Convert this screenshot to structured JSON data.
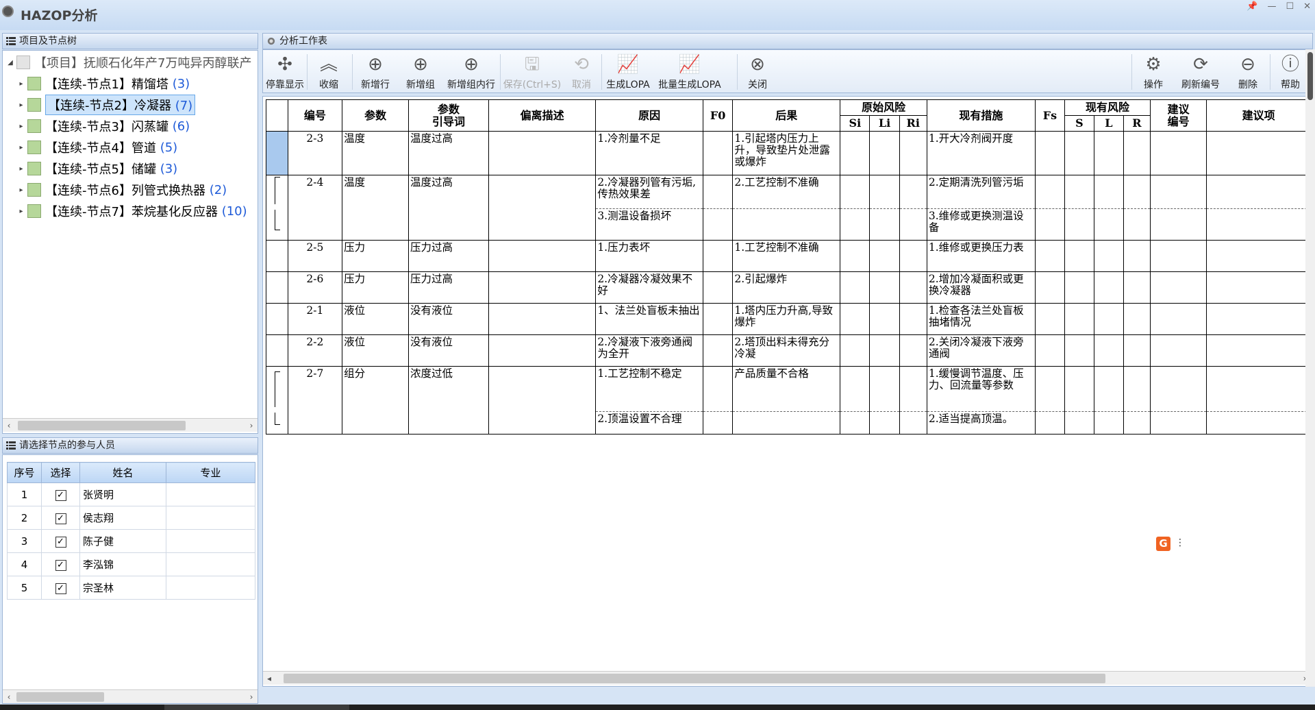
{
  "app": {
    "title": "HAZOP分析"
  },
  "window": {
    "pin": "📌",
    "minimize": "—",
    "maximize": "☐",
    "close": "✕"
  },
  "tree_panel": {
    "header": "项目及节点树",
    "project": "【项目】抚顺石化年产7万吨异丙醇联产",
    "nodes": [
      {
        "label": "【连续-节点1】精馏塔",
        "count": "(3)"
      },
      {
        "label": "【连续-节点2】冷凝器",
        "count": "(7)"
      },
      {
        "label": "【连续-节点3】闪蒸罐",
        "count": "(6)"
      },
      {
        "label": "【连续-节点4】管道",
        "count": "(5)"
      },
      {
        "label": "【连续-节点5】储罐",
        "count": "(3)"
      },
      {
        "label": "【连续-节点6】列管式换热器",
        "count": "(2)"
      },
      {
        "label": "【连续-节点7】苯烷基化反应器",
        "count": "(10)"
      }
    ]
  },
  "people_panel": {
    "header": "请选择节点的参与人员",
    "columns": [
      "序号",
      "选择",
      "姓名",
      "专业"
    ],
    "rows": [
      {
        "no": "1",
        "checked": "✓",
        "name": "张贤明",
        "major": ""
      },
      {
        "no": "2",
        "checked": "✓",
        "name": "侯志翔",
        "major": ""
      },
      {
        "no": "3",
        "checked": "✓",
        "name": "陈子健",
        "major": ""
      },
      {
        "no": "4",
        "checked": "✓",
        "name": "李泓锦",
        "major": ""
      },
      {
        "no": "5",
        "checked": "✓",
        "name": "宗圣林",
        "major": ""
      }
    ]
  },
  "worksheet": {
    "header": "分析工作表",
    "toolbar": {
      "dock": "停靠显示",
      "collapse": "收缩",
      "add_row": "新增行",
      "add_group": "新增组",
      "add_in_group": "新增组内行",
      "save": "保存(Ctrl+S)",
      "cancel": "取消",
      "gen_lopa": "生成LOPA",
      "batch_lopa": "批量生成LOPA",
      "close": "关闭",
      "operate": "操作",
      "refresh_no": "刷新编号",
      "delete": "删除",
      "help": "帮助"
    },
    "columns": {
      "no": "编号",
      "param": "参数",
      "guide": "参数\n引导词",
      "dev": "偏离描述",
      "cause": "原因",
      "f0": "F0",
      "conseq": "后果",
      "orig_risk": "原始风险",
      "si": "Si",
      "li": "Li",
      "ri": "Ri",
      "measures": "现有措施",
      "fs": "Fs",
      "cur_risk": "现有风险",
      "s": "S",
      "l": "L",
      "r": "R",
      "sugg_no": "建议\n编号",
      "sugg": "建议项"
    },
    "rows": [
      {
        "no": "2-3",
        "param": "温度",
        "guide": "温度过高",
        "cause": "1.冷剂量不足",
        "conseq": "1.引起塔内压力上升，导致垫片处泄露或爆炸",
        "measure": "1.开大冷剂阀开度"
      },
      {
        "no": "2-4",
        "param": "温度",
        "guide": "温度过高",
        "cause": "2.冷凝器列管有污垢,传热效果差",
        "conseq": "2.工艺控制不准确",
        "measure": "2.定期清洗列管污垢"
      },
      {
        "no": "",
        "param": "",
        "guide": "",
        "cause": "3.测温设备损坏",
        "conseq": "",
        "measure": "3.维修或更换测温设备"
      },
      {
        "no": "2-5",
        "param": "压力",
        "guide": "压力过高",
        "cause": "1.压力表坏",
        "conseq": "1.工艺控制不准确",
        "measure": "1.维修或更换压力表"
      },
      {
        "no": "2-6",
        "param": "压力",
        "guide": "压力过高",
        "cause": "2.冷凝器冷凝效果不好",
        "conseq": "2.引起爆炸",
        "measure": "2.增加冷凝面积或更换冷凝器"
      },
      {
        "no": "2-1",
        "param": "液位",
        "guide": "没有液位",
        "cause": "1、法兰处盲板未抽出",
        "conseq": "1.塔内压力升高,导致爆炸",
        "measure": "1.检查各法兰处盲板抽堵情况"
      },
      {
        "no": "2-2",
        "param": "液位",
        "guide": "没有液位",
        "cause": "2.冷凝液下液旁通阀为全开",
        "conseq": "2.塔顶出料未得充分冷凝",
        "measure": "2.关闭冷凝液下液旁通阀"
      },
      {
        "no": "2-7",
        "param": "组分",
        "guide": "浓度过低",
        "cause": "1.工艺控制不稳定",
        "conseq": "产品质量不合格",
        "measure": "1.缓慢调节温度、压力、回流量等参数"
      },
      {
        "no": "",
        "param": "",
        "guide": "",
        "cause": "2.顶温设置不合理",
        "conseq": "",
        "measure": "2.适当提高顶温。"
      }
    ]
  },
  "floating": {
    "g": "G",
    "more": "⋮"
  }
}
